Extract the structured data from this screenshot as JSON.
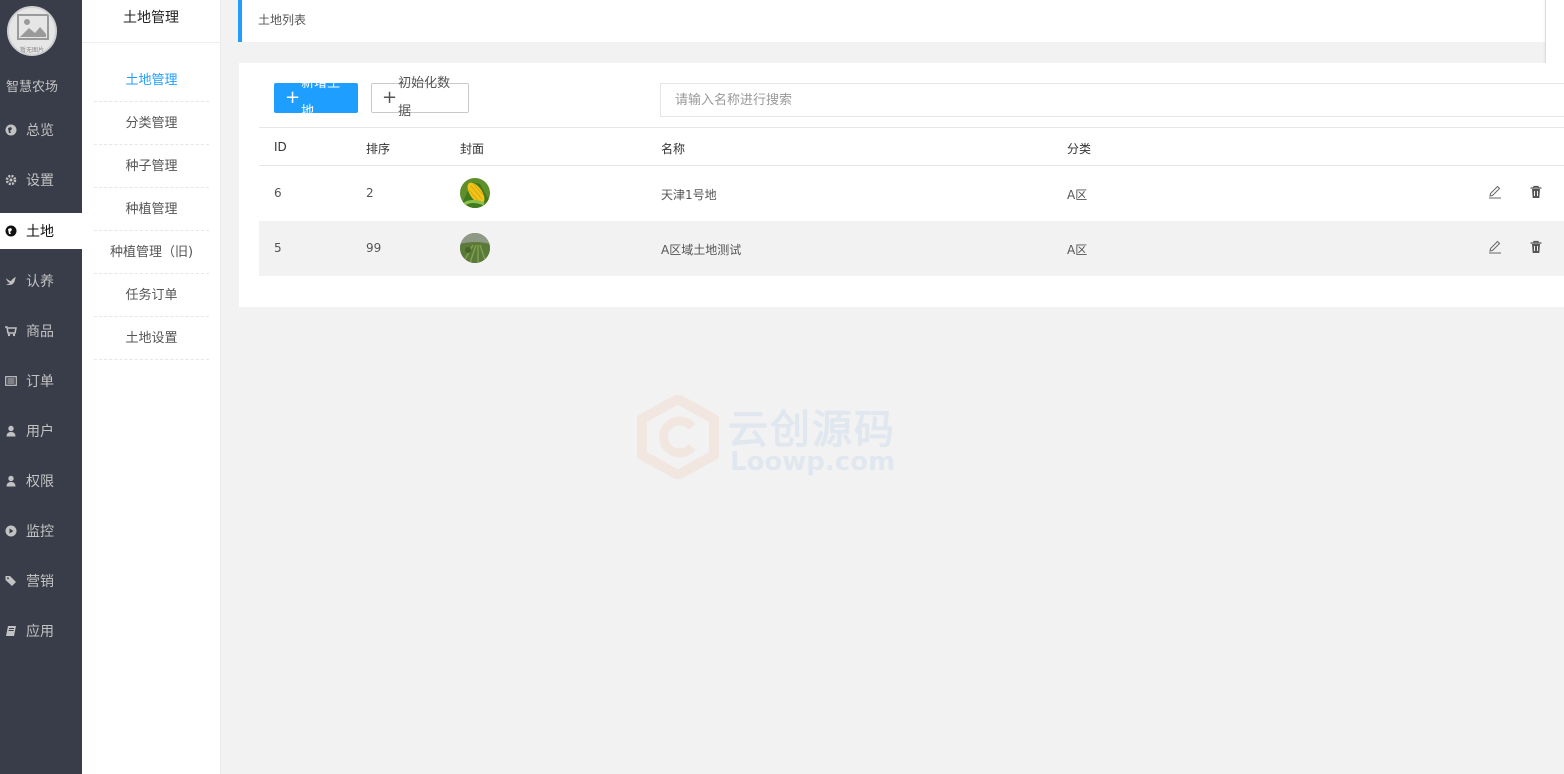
{
  "nav": {
    "logo_caption": "暂无图片",
    "brand": "智慧农场",
    "items": [
      {
        "label": "总览",
        "icon": "globe-icon"
      },
      {
        "label": "设置",
        "icon": "gear-icon"
      },
      {
        "label": "土地",
        "icon": "globe-icon",
        "active": true
      },
      {
        "label": "认养",
        "icon": "bird-icon"
      },
      {
        "label": "商品",
        "icon": "cart-icon"
      },
      {
        "label": "订单",
        "icon": "list-icon"
      },
      {
        "label": "用户",
        "icon": "user-icon"
      },
      {
        "label": "权限",
        "icon": "user-icon"
      },
      {
        "label": "监控",
        "icon": "play-circle-icon"
      },
      {
        "label": "营销",
        "icon": "tags-icon"
      },
      {
        "label": "应用",
        "icon": "book-icon"
      }
    ]
  },
  "submenu": {
    "title": "土地管理",
    "items": [
      {
        "label": "土地管理",
        "active": true
      },
      {
        "label": "分类管理"
      },
      {
        "label": "种子管理"
      },
      {
        "label": "种植管理"
      },
      {
        "label": "种植管理（旧)"
      },
      {
        "label": "任务订单"
      },
      {
        "label": "土地设置"
      }
    ]
  },
  "header": {
    "title": "土地列表"
  },
  "toolbar": {
    "add_label": "新增土地",
    "init_label": "初始化数据",
    "search_placeholder": "请输入名称进行搜索"
  },
  "table": {
    "columns": [
      "ID",
      "排序",
      "封面",
      "名称",
      "分类"
    ],
    "rows": [
      {
        "id": "6",
        "sort": "2",
        "cover": "corn",
        "name": "天津1号地",
        "category": "A区"
      },
      {
        "id": "5",
        "sort": "99",
        "cover": "field",
        "name": "A区域土地测试",
        "category": "A区"
      }
    ]
  },
  "watermark": {
    "line1": "云创源码",
    "line2": "Loowp.com"
  },
  "colors": {
    "accent": "#1e9fff",
    "nav_bg": "#393d49"
  }
}
